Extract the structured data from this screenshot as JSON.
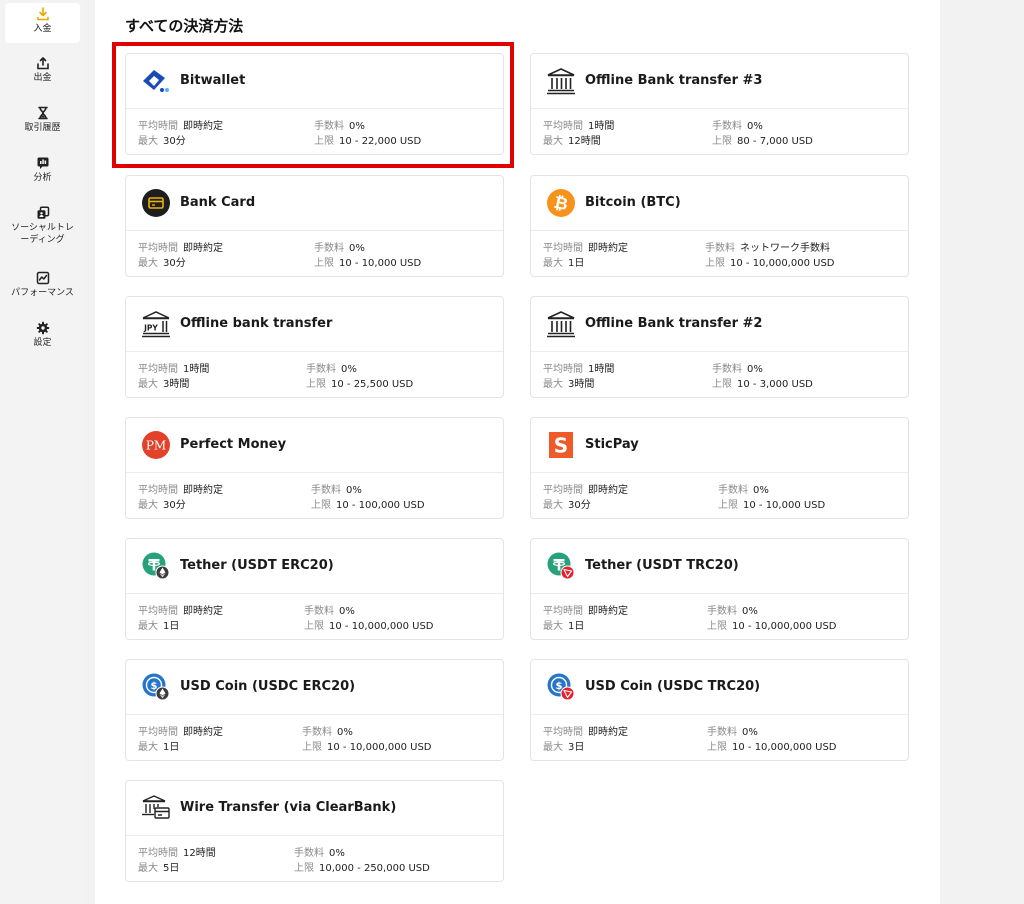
{
  "sidebar": {
    "items": [
      {
        "label": "入金",
        "icon": "download-icon",
        "active": true
      },
      {
        "label": "出金",
        "icon": "upload-icon",
        "active": false
      },
      {
        "label": "取引履歴",
        "icon": "hourglass-icon",
        "active": false
      },
      {
        "label": "分析",
        "icon": "analytics-icon",
        "active": false
      },
      {
        "label": "ソーシャルトレーディング",
        "icon": "copy-trade-icon",
        "active": false
      },
      {
        "label": "パフォーマンス",
        "icon": "performance-icon",
        "active": false
      },
      {
        "label": "設定",
        "icon": "gear-icon",
        "active": false
      }
    ]
  },
  "page": {
    "title": "すべての決済方法"
  },
  "labels": {
    "avg_time": "平均時間",
    "max": "最大",
    "fee": "手数料",
    "limit": "上限"
  },
  "methods": [
    {
      "name": "Bitwallet",
      "icon": "bitwallet-icon",
      "avg_time": "即時約定",
      "max": "30分",
      "fee": "0%",
      "limit": "10 - 22,000 USD"
    },
    {
      "name": "Offline Bank transfer #3",
      "icon": "bank-icon",
      "avg_time": "1時間",
      "max": "12時間",
      "fee": "0%",
      "limit": "80 - 7,000 USD"
    },
    {
      "name": "Bank Card",
      "icon": "card-icon",
      "avg_time": "即時約定",
      "max": "30分",
      "fee": "0%",
      "limit": "10 - 10,000 USD"
    },
    {
      "name": "Bitcoin (BTC)",
      "icon": "bitcoin-icon",
      "avg_time": "即時約定",
      "max": "1日",
      "fee": "ネットワーク手数料",
      "limit": "10 - 10,000,000 USD"
    },
    {
      "name": "Offline bank transfer",
      "icon": "jpy-bank-icon",
      "avg_time": "1時間",
      "max": "3時間",
      "fee": "0%",
      "limit": "10 - 25,500 USD"
    },
    {
      "name": "Offline Bank transfer #2",
      "icon": "bank-icon",
      "avg_time": "1時間",
      "max": "3時間",
      "fee": "0%",
      "limit": "10 - 3,000 USD"
    },
    {
      "name": "Perfect Money",
      "icon": "perfect-money-icon",
      "avg_time": "即時約定",
      "max": "30分",
      "fee": "0%",
      "limit": "10 - 100,000 USD"
    },
    {
      "name": "SticPay",
      "icon": "sticpay-icon",
      "avg_time": "即時約定",
      "max": "30分",
      "fee": "0%",
      "limit": "10 - 10,000 USD"
    },
    {
      "name": "Tether (USDT ERC20)",
      "icon": "tether-erc20-icon",
      "avg_time": "即時約定",
      "max": "1日",
      "fee": "0%",
      "limit": "10 - 10,000,000 USD"
    },
    {
      "name": "Tether (USDT TRC20)",
      "icon": "tether-trc20-icon",
      "avg_time": "即時約定",
      "max": "1日",
      "fee": "0%",
      "limit": "10 - 10,000,000 USD"
    },
    {
      "name": "USD Coin (USDC ERC20)",
      "icon": "usdc-erc20-icon",
      "avg_time": "即時約定",
      "max": "1日",
      "fee": "0%",
      "limit": "10 - 10,000,000 USD"
    },
    {
      "name": "USD Coin (USDC TRC20)",
      "icon": "usdc-trc20-icon",
      "avg_time": "即時約定",
      "max": "3日",
      "fee": "0%",
      "limit": "10 - 10,000,000 USD"
    },
    {
      "name": "Wire Transfer (via ClearBank)",
      "icon": "wire-transfer-icon",
      "avg_time": "12時間",
      "max": "5日",
      "fee": "0%",
      "limit": "10,000 - 250,000 USD"
    }
  ],
  "colors": {
    "highlight": "#e00000",
    "active_icon": "#e8a800",
    "bitwallet": "#1a4bb5",
    "bitcoin": "#f7931a",
    "perfect_money": "#e2412a",
    "sticpay": "#f05a28",
    "tether": "#26a17b",
    "usdc": "#2775ca",
    "tron": "#e8212e"
  }
}
